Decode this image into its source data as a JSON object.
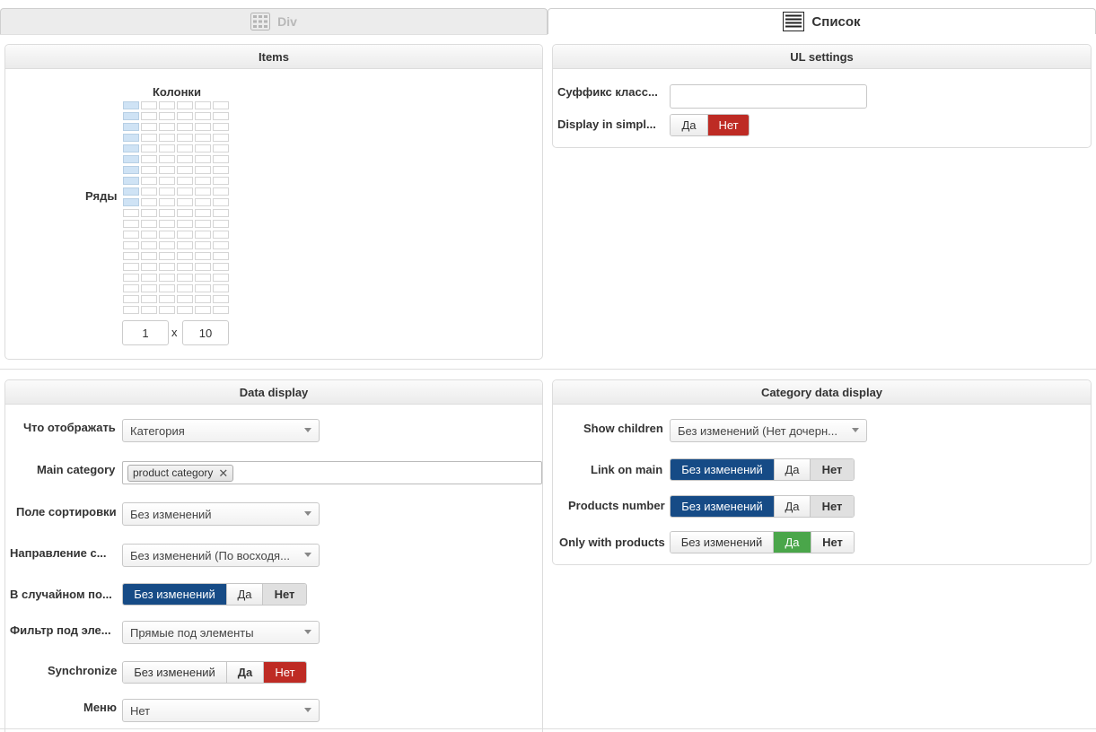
{
  "tabs": [
    {
      "label": "Div",
      "icon": "grid-icon",
      "active": false
    },
    {
      "label": "Список",
      "icon": "list-icon",
      "active": true
    }
  ],
  "items_panel": {
    "title": "Items",
    "columns_label": "Колонки",
    "rows_label": "Ряды",
    "columns_value": "1",
    "times": "x",
    "rows_value": "10",
    "grid_total_cols": 6,
    "grid_total_rows": 20
  },
  "ul_settings": {
    "title": "UL settings",
    "class_suffix_label": "Суффикс класс...",
    "class_suffix_value": "",
    "display_simple_label": "Display in simpl...",
    "display_simple_options": [
      "Да",
      "Нет"
    ],
    "display_simple_selected": "Нет"
  },
  "data_display": {
    "title": "Data display",
    "what_label": "Что отображать",
    "what_value": "Категория",
    "main_category_label": "Main category",
    "main_category_tag": "product category",
    "sort_field_label": "Поле сортировки",
    "sort_field_value": "Без изменений",
    "direction_label": "Направление с...",
    "direction_value": "Без изменений (По восходя...",
    "random_label": "В случайном по...",
    "random_options": [
      "Без изменений",
      "Да",
      "Нет"
    ],
    "random_selected": "Без изменений",
    "filter_label": "Фильтр под эле...",
    "filter_value": "Прямые под элементы",
    "sync_label": "Synchronize",
    "sync_options": [
      "Без изменений",
      "Да",
      "Нет"
    ],
    "sync_selected": "Нет",
    "menu_label": "Меню",
    "menu_value": "Нет"
  },
  "category_display": {
    "title": "Category data display",
    "show_children_label": "Show children",
    "show_children_value": "Без изменений (Нет дочерн...",
    "link_main_label": "Link on main",
    "link_main_options": [
      "Без изменений",
      "Да",
      "Нет"
    ],
    "link_main_selected": "Без изменений",
    "products_number_label": "Products number",
    "products_number_options": [
      "Без изменений",
      "Да",
      "Нет"
    ],
    "products_number_selected": "Без изменений",
    "only_products_label": "Only with products",
    "only_products_options": [
      "Без изменений",
      "Да",
      "Нет"
    ],
    "only_products_selected": "Да"
  },
  "colors": {
    "selected_blue": "#164b86",
    "selected_red": "#be2b24",
    "selected_green": "#4aa64a",
    "grid_selected": "#cfe3f5"
  }
}
